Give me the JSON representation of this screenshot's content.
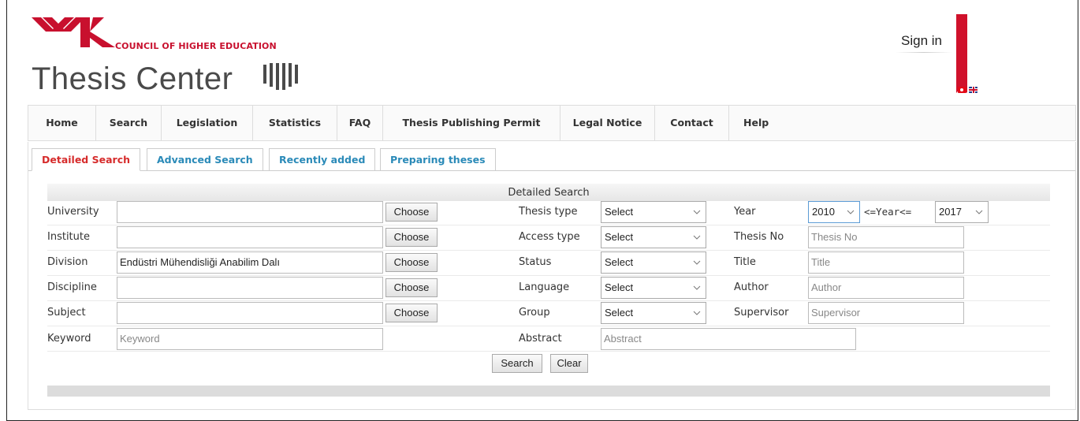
{
  "header": {
    "council": "COUNCIL OF HIGHER EDUCATION",
    "title": "Thesis Center",
    "sign_in": "Sign in",
    "brand_color": "#c8102e"
  },
  "nav": {
    "items": [
      "Home",
      "Search",
      "Legislation",
      "Statistics",
      "FAQ",
      "Thesis Publishing Permit",
      "Legal Notice",
      "Contact",
      "Help"
    ]
  },
  "tabs": {
    "detailed": "Detailed Search",
    "advanced": "Advanced Search",
    "recent": "Recently added",
    "preparing": "Preparing theses"
  },
  "form": {
    "heading": "Detailed Search",
    "left": {
      "university": {
        "label": "University",
        "value": ""
      },
      "institute": {
        "label": "Institute",
        "value": ""
      },
      "division": {
        "label": "Division",
        "value": "Endüstri Mühendisliği Anabilim Dalı"
      },
      "discipline": {
        "label": "Discipline",
        "value": ""
      },
      "subject": {
        "label": "Subject",
        "value": ""
      },
      "keyword": {
        "label": "Keyword",
        "placeholder": "Keyword"
      },
      "choose_label": "Choose"
    },
    "middle": {
      "thesis_type": {
        "label": "Thesis type",
        "selected": "Select"
      },
      "access_type": {
        "label": "Access type",
        "selected": "Select"
      },
      "status": {
        "label": "Status",
        "selected": "Select"
      },
      "language": {
        "label": "Language",
        "selected": "Select"
      },
      "group": {
        "label": "Group",
        "selected": "Select"
      },
      "abstract": {
        "label": "Abstract",
        "placeholder": "Abstract"
      }
    },
    "right": {
      "year": {
        "label": "Year",
        "from": "2010",
        "separator": "<=Year<=",
        "to": "2017"
      },
      "thesis_no": {
        "label": "Thesis No",
        "placeholder": "Thesis No"
      },
      "title": {
        "label": "Title",
        "placeholder": "Title"
      },
      "author": {
        "label": "Author",
        "placeholder": "Author"
      },
      "supervisor": {
        "label": "Supervisor",
        "placeholder": "Supervisor"
      }
    },
    "search_button": "Search",
    "clear_button": "Clear"
  }
}
